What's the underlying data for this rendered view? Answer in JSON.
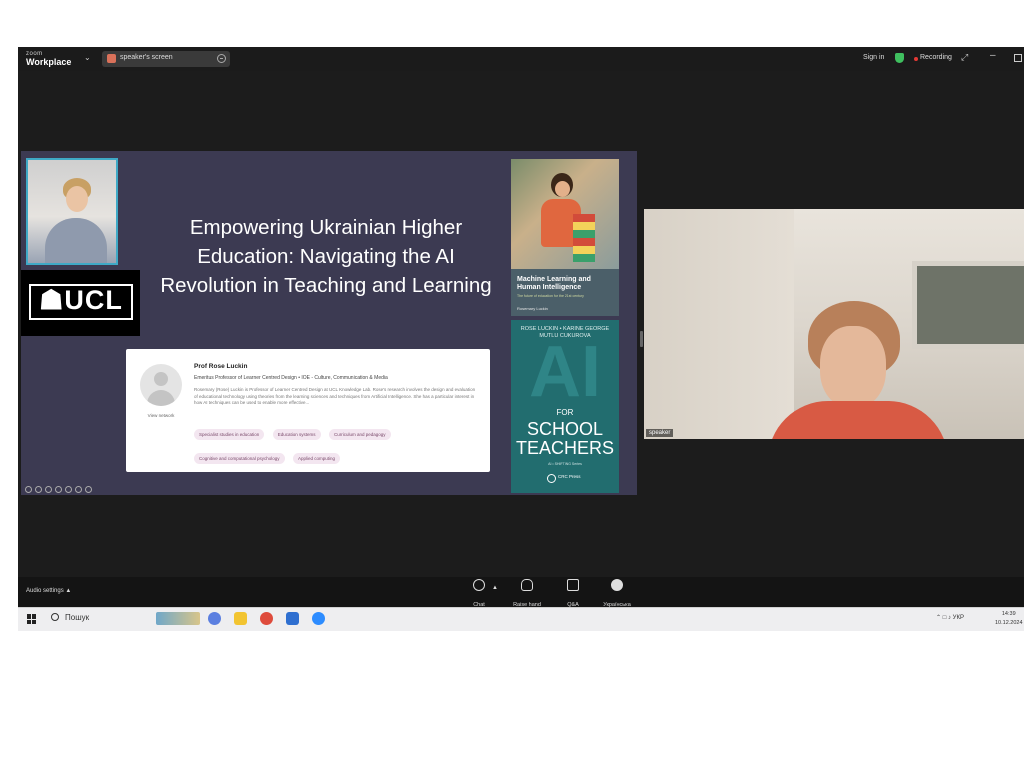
{
  "window": {
    "app_name_top": "zoom",
    "app_name": "Workplace",
    "share_tab_label": "speaker's screen",
    "sign_in": "Sign in",
    "recording_label": "Recording"
  },
  "slide": {
    "title": "Empowering Ukrainian Higher Education: Navigating the AI Revolution in Teaching and Learning",
    "logo_text": "☗UCL"
  },
  "profile_card": {
    "name": "Prof Rose Luckin",
    "role": "Emeritus Professor of Learner Centred Design • IOE - Culture, Communication & Media",
    "bio": "Rosemary (Rose) Luckin is Professor of Learner Centred Design at UCL Knowledge Lab. Rose's research involves the design and evaluation of educational technology using theories from the learning sciences and techniques from Artificial Intelligence. She has a particular interest in how AI techniques can be used to enable more effective...",
    "view_network": "View network",
    "tags": [
      "Specialist studies in education",
      "Education systems",
      "Curriculum and pedagogy",
      "Cognitive and computational psychology",
      "Applied computing"
    ]
  },
  "book1": {
    "title": "Machine Learning and Human Intelligence",
    "subtitle": "The future of education for the 21st century",
    "author": "Rosemary Luckin"
  },
  "book2": {
    "authors": "ROSE LUCKIN • KARINE GEORGE MUTLU CUKUROVA",
    "big": "AI",
    "for_label": "FOR",
    "title_line1": "SCHOOL",
    "title_line2": "TEACHERS",
    "series": "AI • SHIFTING Series",
    "publisher": "CRC Press"
  },
  "speaker_video": {
    "label": "speaker"
  },
  "toolbar": {
    "audio_settings": "Audio settings",
    "items": [
      "Chat",
      "Raise hand",
      "Q&A",
      "Українська"
    ]
  },
  "taskbar": {
    "search_label": "Пошук",
    "language": "УКР",
    "time": "14:39",
    "date": "10.12.2024"
  },
  "colors": {
    "slide_bg": "#3c3a52",
    "ucl_bg": "#000000",
    "book2_bg": "#226d6f",
    "recording_dot": "#e53935",
    "shield": "#3fbf5f",
    "tag_bg": "#f3e6f0"
  }
}
